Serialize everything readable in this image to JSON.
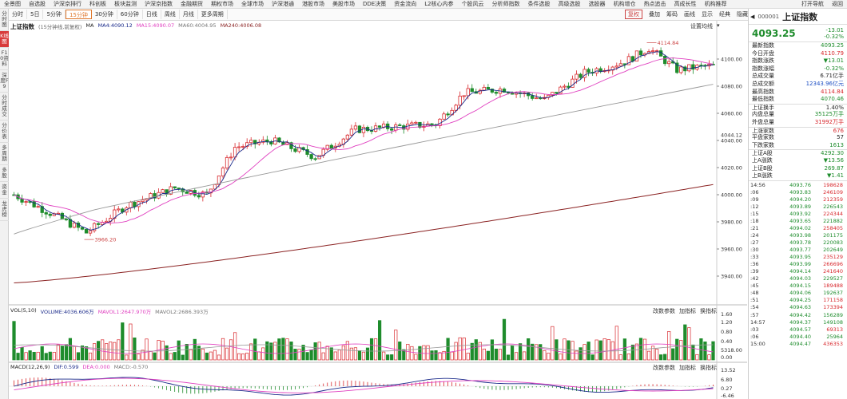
{
  "menu": {
    "items": [
      "全景图",
      "自选股",
      "沪深京排行",
      "科创板",
      "板块监测",
      "沪深京指数",
      "金融期货",
      "期权市场",
      "全球市场",
      "沪深港通",
      "港股市场",
      "美股市场",
      "DDE决策",
      "资金流向",
      "L2核心内参",
      "个股风云",
      "分析师指数",
      "条件选股",
      "高级选股",
      "选股器",
      "机构增仓",
      "热点追击",
      "高成长性",
      "机构推荐"
    ],
    "right": [
      "打开导航",
      "返回"
    ]
  },
  "toolbar": {
    "periods": [
      "分时",
      "5日",
      "5分钟",
      "15分钟",
      "30分钟",
      "60分钟",
      "日线",
      "周线",
      "月线",
      "更多周期"
    ],
    "active_period": "15分钟",
    "tools": [
      "复权",
      "叠加",
      "筹码",
      "画线",
      "显示",
      "经典",
      "隐藏"
    ],
    "fuquan_label": "复权"
  },
  "left_tabs": [
    "分时图",
    "K线图",
    "F10资料",
    "深度F9",
    "分时成交",
    "分价表",
    "多周期",
    "多股",
    "资金",
    "龙虎榜"
  ],
  "left_tab_active": "K线图",
  "main_chart": {
    "title": "上证指数",
    "subtitle": "(15分钟线,前复权)",
    "ma_label": "MA",
    "ma_values": [
      "MA4:4090.12",
      "MA15:4090.07",
      "MA60:4004.95",
      "MA240:4006.08"
    ],
    "settings_label": "设置均线",
    "y_ticks": [
      "4100.00",
      "4080.00",
      "4060.00",
      "4044.12",
      "4040.00",
      "4020.00",
      "4000.00",
      "3980.00",
      "3960.00",
      "3940.00"
    ],
    "high_label": "4114.84",
    "low_label": "3966.20",
    "colors": {
      "up": "#d8282d",
      "down": "#1e8c2c",
      "ma4": "#1a2a8a",
      "ma15": "#e040c0",
      "ma60": "#999999",
      "ma240": "#8b2323"
    }
  },
  "vol_panel": {
    "title": "VOL(5,10)",
    "values": [
      "VOLUME:4036.606万",
      "MAVOL1:2647.970万",
      "MAVOL2:2686.393万"
    ],
    "buttons": [
      "改数参数",
      "加指标",
      "换指标"
    ],
    "y_ticks": [
      "1.60",
      "1.20",
      "0.80",
      "0.40",
      "5318.00",
      "0.00"
    ]
  },
  "macd_panel": {
    "title": "MACD(12,26,9)",
    "values": [
      "DIF:0.599",
      "DEA:0.000",
      "MACD:-0.570"
    ],
    "buttons": [
      "改数参数",
      "加指标",
      "换指标"
    ],
    "y_ticks": [
      "13.52",
      "6.80",
      "0.27",
      "-6.46"
    ]
  },
  "quote": {
    "code": "000001",
    "name": "上证指数",
    "price": "4093.25",
    "change": "-13.01",
    "change_pct": "-0.32%",
    "stats": [
      {
        "label": "最新指数",
        "value": "4093.25",
        "color": "green"
      },
      {
        "label": "今日开盘",
        "value": "4110.79",
        "color": "red"
      },
      {
        "label": "指数涨跌",
        "value": "▼13.01",
        "color": "green"
      },
      {
        "label": "指数涨幅",
        "value": "-0.32%",
        "color": "green"
      },
      {
        "label": "总成交量",
        "value": "6.71亿手",
        "color": "black"
      },
      {
        "label": "总成交额",
        "value": "12343.96亿元",
        "color": "blue"
      },
      {
        "label": "最高指数",
        "value": "4114.84",
        "color": "red"
      },
      {
        "label": "最低指数",
        "value": "4070.46",
        "color": "green"
      }
    ],
    "stats2": [
      {
        "label": "上证换手",
        "value": "1.40%",
        "color": "black"
      },
      {
        "label": "内盘总量",
        "value": "35125万手",
        "color": "green"
      },
      {
        "label": "外盘总量",
        "value": "31992万手",
        "color": "red"
      }
    ],
    "stats3": [
      {
        "label": "上涨家数",
        "value": "676",
        "color": "red"
      },
      {
        "label": "平盘家数",
        "value": "57",
        "color": "black"
      },
      {
        "label": "下跌家数",
        "value": "1613",
        "color": "green"
      }
    ],
    "stats4": [
      {
        "label": "上证A股",
        "value": "4292.30",
        "color": "green"
      },
      {
        "label": "上A涨跌",
        "value": "▼13.56",
        "color": "green"
      },
      {
        "label": "上证B股",
        "value": "269.87",
        "color": "green"
      },
      {
        "label": "上B涨跌",
        "value": "▼1.41",
        "color": "green"
      }
    ],
    "ticks": [
      {
        "t": "14:56",
        "p": "4093.76",
        "v": "198628",
        "pc": "green",
        "vc": "red"
      },
      {
        "t": ":06",
        "p": "4093.83",
        "v": "246109",
        "pc": "green",
        "vc": "red"
      },
      {
        "t": ":09",
        "p": "4094.20",
        "v": "212359",
        "pc": "green",
        "vc": "red"
      },
      {
        "t": ":12",
        "p": "4093.89",
        "v": "226543",
        "pc": "green",
        "vc": "green"
      },
      {
        "t": ":15",
        "p": "4093.92",
        "v": "224344",
        "pc": "green",
        "vc": "red"
      },
      {
        "t": ":18",
        "p": "4093.65",
        "v": "221882",
        "pc": "green",
        "vc": "green"
      },
      {
        "t": ":21",
        "p": "4094.02",
        "v": "258405",
        "pc": "green",
        "vc": "red"
      },
      {
        "t": ":24",
        "p": "4093.98",
        "v": "201175",
        "pc": "green",
        "vc": "green"
      },
      {
        "t": ":27",
        "p": "4093.78",
        "v": "220083",
        "pc": "green",
        "vc": "green"
      },
      {
        "t": ":30",
        "p": "4093.77",
        "v": "202649",
        "pc": "green",
        "vc": "green"
      },
      {
        "t": ":33",
        "p": "4093.95",
        "v": "235129",
        "pc": "green",
        "vc": "red"
      },
      {
        "t": ":36",
        "p": "4093.99",
        "v": "266696",
        "pc": "green",
        "vc": "red"
      },
      {
        "t": ":39",
        "p": "4094.14",
        "v": "241640",
        "pc": "green",
        "vc": "red"
      },
      {
        "t": ":42",
        "p": "4094.03",
        "v": "229527",
        "pc": "green",
        "vc": "green"
      },
      {
        "t": ":45",
        "p": "4094.15",
        "v": "189488",
        "pc": "green",
        "vc": "red"
      },
      {
        "t": ":48",
        "p": "4094.06",
        "v": "192637",
        "pc": "green",
        "vc": "green"
      },
      {
        "t": ":51",
        "p": "4094.25",
        "v": "171158",
        "pc": "green",
        "vc": "red"
      },
      {
        "t": ":54",
        "p": "4094.63",
        "v": "173394",
        "pc": "green",
        "vc": "red"
      },
      {
        "t": ":57",
        "p": "4094.42",
        "v": "156289",
        "pc": "green",
        "vc": "green"
      },
      {
        "t": "14:57",
        "p": "4094.37",
        "v": "149108",
        "pc": "green",
        "vc": "green"
      },
      {
        "t": ":03",
        "p": "4094.57",
        "v": "69313",
        "pc": "green",
        "vc": "red"
      },
      {
        "t": ":06",
        "p": "4094.40",
        "v": "25964",
        "pc": "green",
        "vc": "green"
      },
      {
        "t": "15:00",
        "p": "4094.47",
        "v": "436353",
        "pc": "green",
        "vc": "red"
      }
    ]
  }
}
